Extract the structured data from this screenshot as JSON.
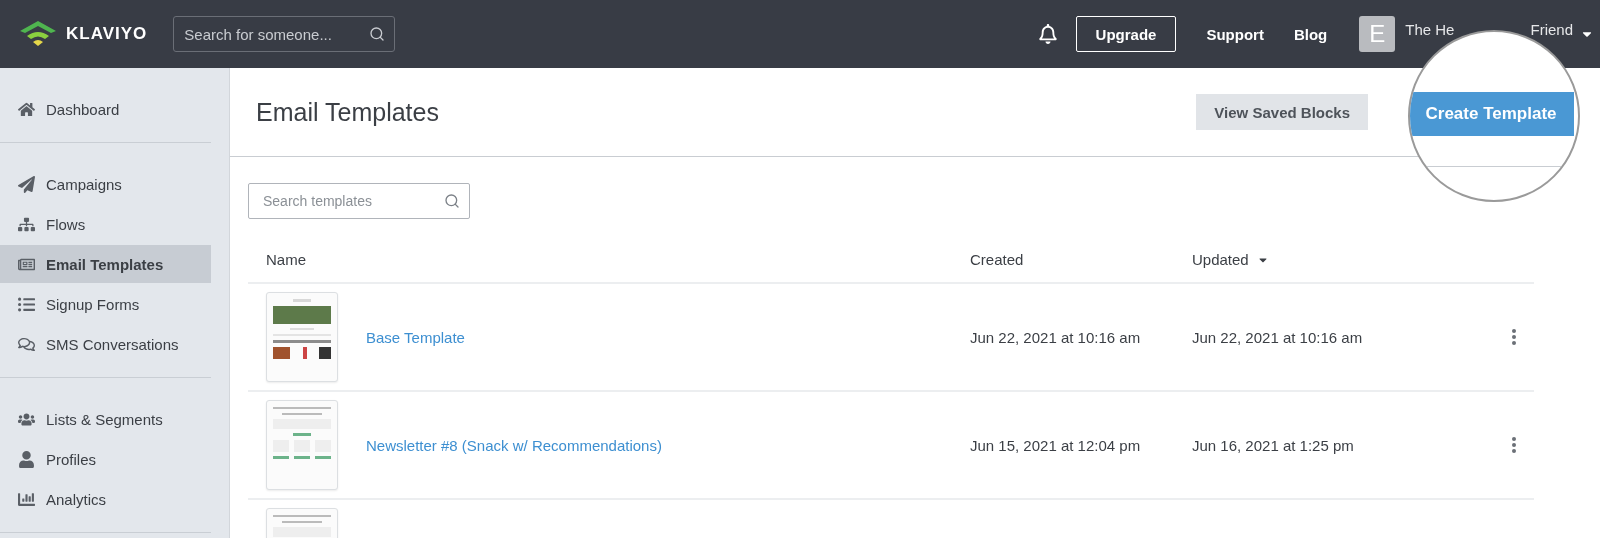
{
  "header": {
    "brand": "KLAVIYO",
    "search": {
      "placeholder": "Search for someone..."
    },
    "upgrade": "Upgrade",
    "links": [
      "Support",
      "Blog"
    ],
    "avatar_letter": "E",
    "account_name_parts": [
      "The He",
      "Friend"
    ]
  },
  "sidebar": {
    "groups": [
      [
        {
          "label": "Dashboard",
          "selected": false
        }
      ],
      [
        {
          "label": "Campaigns",
          "selected": false
        },
        {
          "label": "Flows",
          "selected": false
        },
        {
          "label": "Email Templates",
          "selected": true
        },
        {
          "label": "Signup Forms",
          "selected": false
        },
        {
          "label": "SMS Conversations",
          "selected": false
        }
      ],
      [
        {
          "label": "Lists & Segments",
          "selected": false
        },
        {
          "label": "Profiles",
          "selected": false
        },
        {
          "label": "Analytics",
          "selected": false
        }
      ]
    ]
  },
  "page": {
    "title": "Email Templates",
    "secondary_button": "View Saved Blocks",
    "primary_button": "Create Template",
    "search": {
      "placeholder": "Search templates"
    }
  },
  "table": {
    "columns": [
      "Name",
      "Created",
      "Updated"
    ],
    "rows": [
      {
        "kind": "full",
        "name": "Base Template",
        "created": "Jun 22, 2021 at 10:16 am",
        "updated": "Jun 22, 2021 at 10:16 am"
      },
      {
        "kind": "full",
        "name": "Newsletter #8 (Snack w/ Recommendations)",
        "created": "Jun 15, 2021 at 12:04 pm",
        "updated": "Jun 16, 2021 at 1:25 pm"
      },
      {
        "kind": "partial"
      }
    ]
  }
}
